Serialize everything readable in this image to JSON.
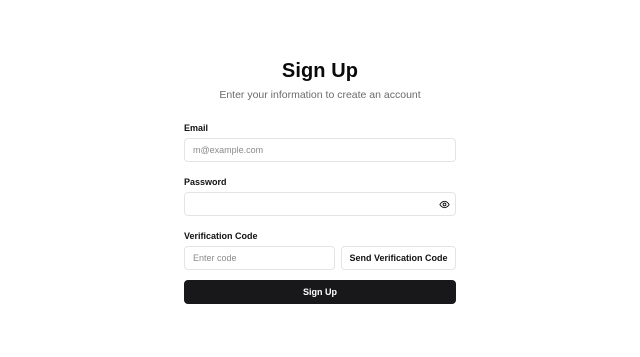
{
  "header": {
    "title": "Sign Up",
    "subtitle": "Enter your information to create an account"
  },
  "form": {
    "email": {
      "label": "Email",
      "placeholder": "m@example.com",
      "value": ""
    },
    "password": {
      "label": "Password",
      "placeholder": "",
      "value": "",
      "toggle_icon": "eye-icon"
    },
    "verification": {
      "label": "Verification Code",
      "placeholder": "Enter code",
      "value": "",
      "send_label": "Send Verification Code"
    },
    "submit_label": "Sign Up"
  },
  "colors": {
    "primary_button": "#18181b",
    "border": "#e4e4e7",
    "muted_text": "#6b6b6b"
  }
}
